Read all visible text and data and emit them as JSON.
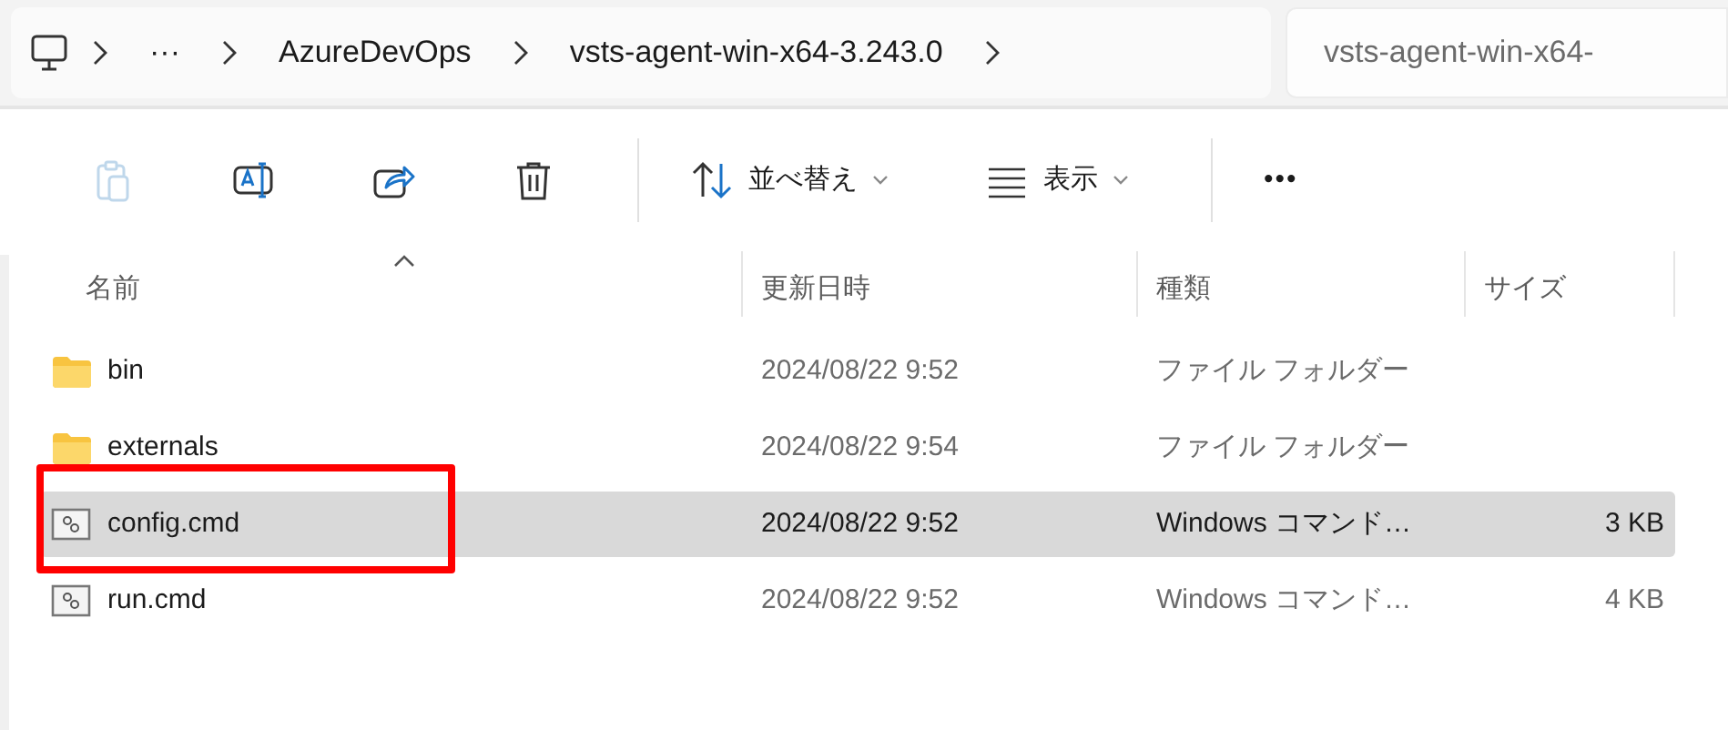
{
  "breadcrumb": {
    "items": [
      {
        "kind": "computer"
      },
      {
        "kind": "more",
        "label": "···"
      },
      {
        "kind": "folder",
        "label": "AzureDevOps"
      },
      {
        "kind": "folder",
        "label": "vsts-agent-win-x64-3.243.0"
      }
    ]
  },
  "search": {
    "placeholder": "vsts-agent-win-x64-"
  },
  "toolbar": [
    {
      "kind": "paste",
      "disabled": true
    },
    {
      "kind": "rename",
      "disabled": false
    },
    {
      "kind": "share",
      "disabled": false
    },
    {
      "kind": "delete",
      "disabled": false
    },
    {
      "kind": "sort",
      "label": "並べ替え",
      "disabled": false
    },
    {
      "kind": "view",
      "label": "表示",
      "disabled": false
    },
    {
      "kind": "more",
      "label": "•••",
      "disabled": false
    }
  ],
  "table": {
    "columns": [
      "名前",
      "更新日時",
      "種類",
      "サイズ"
    ],
    "rows": [
      {
        "kind": "folder",
        "name": "bin",
        "modified": "2024/08/22 9:52",
        "type": "ファイル フォルダー",
        "selected": false,
        "highlighted": false
      },
      {
        "kind": "folder",
        "name": "externals",
        "modified": "2024/08/22 9:54",
        "type": "ファイル フォルダー",
        "selected": false,
        "highlighted": false
      },
      {
        "kind": "cmd",
        "name": "config.cmd",
        "modified": "2024/08/22 9:52",
        "type": "Windows コマンド…",
        "size": "3 KB",
        "selected": true,
        "highlighted": true
      },
      {
        "kind": "cmd",
        "name": "run.cmd",
        "modified": "2024/08/22 9:52",
        "type": "Windows コマンド…",
        "size": "4 KB",
        "selected": false,
        "highlighted": false
      }
    ]
  }
}
